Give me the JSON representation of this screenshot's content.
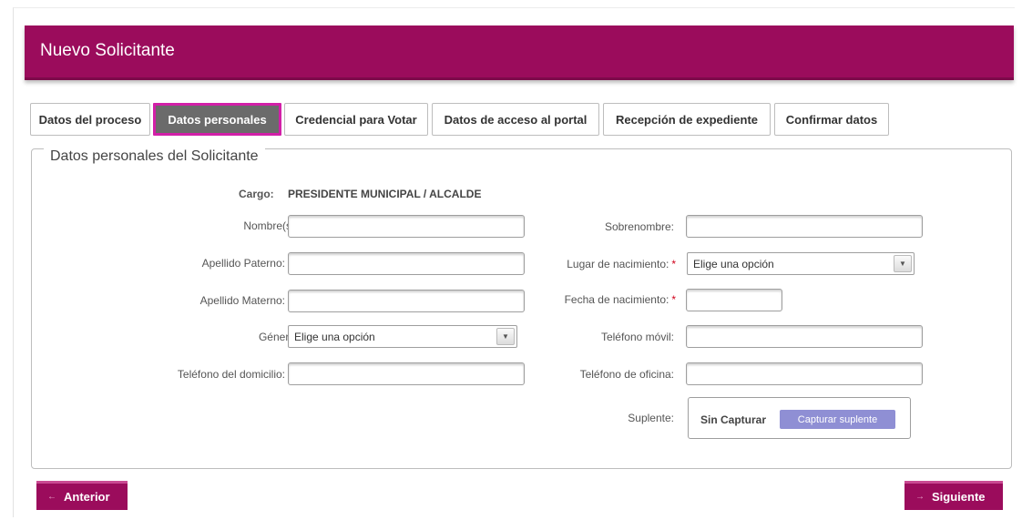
{
  "header": {
    "title": "Nuevo Solicitante"
  },
  "tabs": [
    {
      "label": "Datos del proceso"
    },
    {
      "label": "Datos personales",
      "active": true
    },
    {
      "label": "Credencial para Votar"
    },
    {
      "label": "Datos de acceso al portal"
    },
    {
      "label": "Recepción de expediente"
    },
    {
      "label": "Confirmar datos"
    }
  ],
  "panel": {
    "legend": "Datos personales del Solicitante"
  },
  "cargo": {
    "label": "Cargo:",
    "value": "PRESIDENTE MUNICIPAL / ALCALDE"
  },
  "form": {
    "nombres": {
      "label": "Nombre(s):",
      "required": "*",
      "value": ""
    },
    "apellido_paterno": {
      "label": "Apellido Paterno:",
      "value": ""
    },
    "apellido_materno": {
      "label": "Apellido Materno:",
      "value": ""
    },
    "genero": {
      "label": "Género:",
      "required": "*",
      "selected": "Elige una opción"
    },
    "telefono_domicilio": {
      "label": "Teléfono del domicilio:",
      "value": ""
    },
    "sobrenombre": {
      "label": "Sobrenombre:",
      "value": ""
    },
    "lugar_nacimiento": {
      "label": "Lugar de nacimiento:",
      "required": "*",
      "selected": "Elige una opción"
    },
    "fecha_nacimiento": {
      "label": "Fecha de nacimiento:",
      "required": "*",
      "value": ""
    },
    "telefono_movil": {
      "label": "Teléfono móvil:",
      "value": ""
    },
    "telefono_oficina": {
      "label": "Teléfono de oficina:",
      "value": ""
    },
    "suplente": {
      "label": "Suplente:",
      "status": "Sin Capturar",
      "button": "Capturar suplente"
    }
  },
  "footer": {
    "prev": {
      "label": "Anterior",
      "icon": "chevron-left-icon"
    },
    "next": {
      "label": "Siguiente",
      "icon": "chevron-right-icon"
    }
  },
  "colors": {
    "brand": "#9b0c5c",
    "active_tab": "#6b6b6b",
    "active_tab_border": "#d21fa8",
    "capture_button": "#8f8fd4",
    "required": "#d0021b"
  }
}
